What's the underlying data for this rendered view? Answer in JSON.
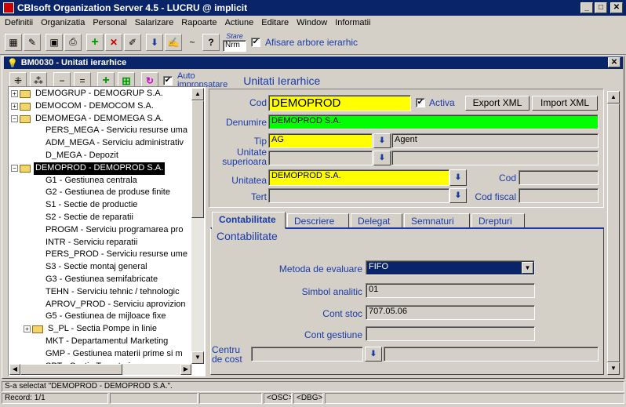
{
  "app": {
    "title": "CBIsoft Organization Server 4.5 - LUCRU @ implicit"
  },
  "menu": [
    "Definitii",
    "Organizatia",
    "Personal",
    "Salarizare",
    "Rapoarte",
    "Actiune",
    "Editare",
    "Window",
    "Informatii"
  ],
  "toolbar": {
    "stare_label": "Stare",
    "stare_value": "Nrm",
    "afisare_label": "Afisare arbore ierarhic",
    "afisare_checked": "✔"
  },
  "child": {
    "title": "BM0030 - Unitati ierarhice",
    "auto_label_1": "Auto",
    "auto_label_2": "impropsatare",
    "auto_checked": "✔",
    "heading": "Unitati Ierarhice"
  },
  "tree": {
    "items": [
      "DEMOGRUP - DEMOGRUP S.A.",
      "DEMOCOM - DEMOCOM S.A.",
      "DEMOMEGA - DEMOMEGA S.A.",
      "PERS_MEGA - Serviciu resurse uma",
      "ADM_MEGA - Serviciu administrativ",
      "D_MEGA - Depozit",
      "DEMOPROD - DEMOPROD S.A.",
      "G1 - Gestiunea centrala",
      "G2 - Gestiunea de produse finite",
      "S1 - Sectie de productie",
      "S2 - Sectie de reparatii",
      "PROGM - Serviciu programarea pro",
      "INTR - Serviciu reparatii",
      "PERS_PROD - Serviciu resurse ume",
      "S3 - Sectie montaj general",
      "G3 - Gestiunea semifabricate",
      "TEHN - Serviciu tehnic / tehnologic",
      "APROV_PROD - Serviciu aprovizion",
      "G5 - Gestiunea de mijloace fixe",
      "S_PL - Sectia Pompe in linie",
      "MKT - Departamentul Marketing",
      "GMP - Gestiunea materii prime si m",
      "SPT - Sectie Turnatorie"
    ]
  },
  "form": {
    "cod_label": "Cod",
    "cod_value": "DEMOPROD",
    "activa_label": "Activa",
    "activa_checked": "✔",
    "export_btn": "Export XML",
    "import_btn": "Import XML",
    "denumire_label": "Denumire",
    "denumire_value": "DEMOPROD S.A.",
    "tip_label": "Tip",
    "tip_value": "AG",
    "tip_desc": "Agent",
    "unit_sup_label_1": "Unitate",
    "unit_sup_label_2": "superioara",
    "unitatea_label": "Unitatea",
    "unitatea_value": "DEMOPROD S.A.",
    "cod2_label": "Cod",
    "tert_label": "Tert",
    "cod_fiscal_label": "Cod fiscal"
  },
  "tabs": [
    "Contabilitate",
    "Descriere",
    "Delegat",
    "Semnaturi",
    "Drepturi"
  ],
  "tab_panel": {
    "heading": "Contabilitate",
    "metoda_label": "Metoda de evaluare",
    "metoda_value": "FIFO",
    "simbol_label": "Simbol analitic",
    "simbol_value": "01",
    "cont_stoc_label": "Cont stoc",
    "cont_stoc_value": "707.05.06",
    "cont_gest_label": "Cont gestiune",
    "centru_label_1": "Centru",
    "centru_label_2": "de cost"
  },
  "status": {
    "message": "S-a selectat \"DEMOPROD - DEMOPROD S.A.\".",
    "record": "Record: 1/1",
    "osc": "<OSC>",
    "dbg": "<DBG>"
  }
}
